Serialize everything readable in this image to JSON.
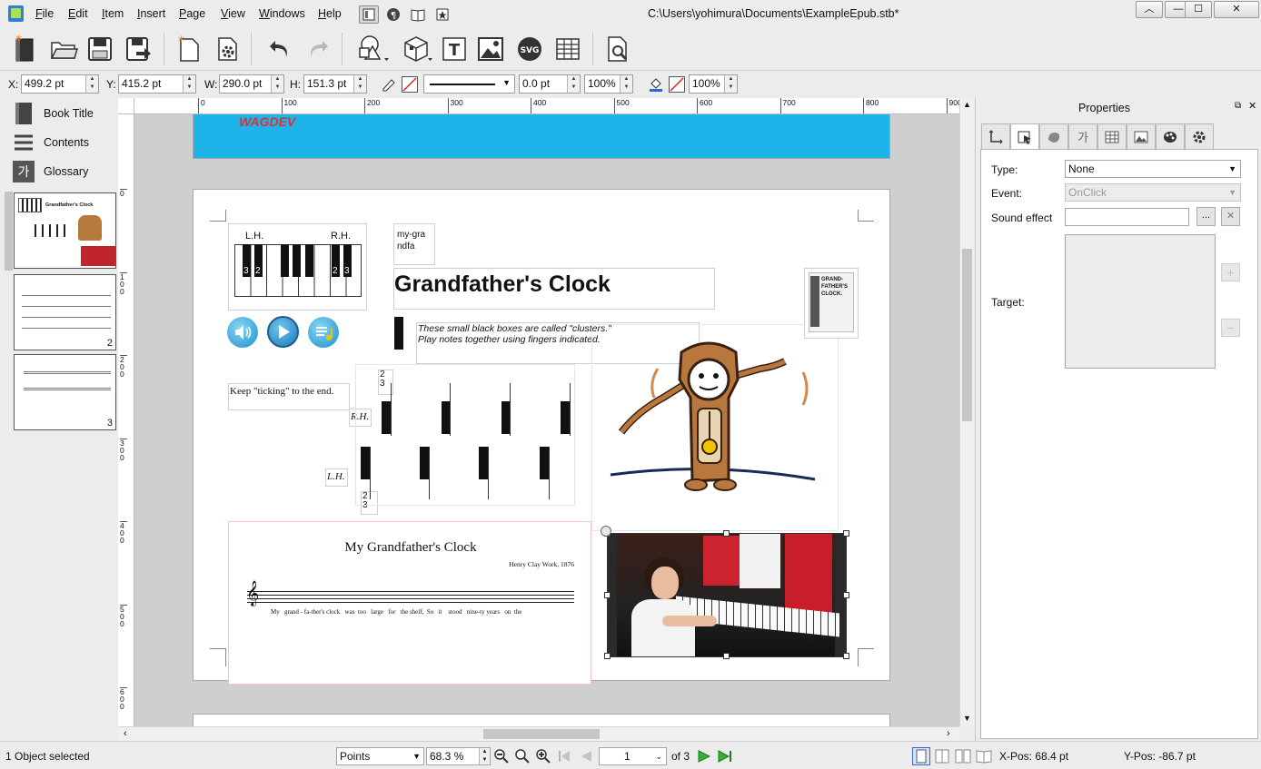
{
  "menubar": {
    "items": [
      "File",
      "Edit",
      "Item",
      "Insert",
      "Page",
      "View",
      "Windows",
      "Help"
    ],
    "window_title": "C:\\Users\\yohimura\\Documents\\ExampleEpub.stb*"
  },
  "window_controls": {
    "collapse": "︿",
    "minimize": "—",
    "maximize": "☐",
    "close": "✕"
  },
  "geometry": {
    "x_label": "X:",
    "x_value": "499.2 pt",
    "y_label": "Y:",
    "y_value": "415.2 pt",
    "w_label": "W:",
    "w_value": "290.0 pt",
    "h_label": "H:",
    "h_value": "151.3 pt",
    "line_width": "0.0 pt",
    "line_opacity": "100%",
    "fill_opacity": "100%"
  },
  "sidebar": {
    "items": [
      {
        "label": "Book Title"
      },
      {
        "label": "Contents"
      },
      {
        "label": "Glossary",
        "icon_text": "가"
      }
    ],
    "thumbnails": [
      {
        "title": "Grandfather's Clock",
        "page": ""
      },
      {
        "page": "2"
      },
      {
        "page": "3"
      }
    ]
  },
  "ruler": {
    "h_ticks": [
      "0",
      "100",
      "200",
      "300",
      "400",
      "500",
      "600",
      "700",
      "800",
      "900"
    ],
    "v_ticks": [
      "0",
      "100",
      "200",
      "300",
      "400",
      "500",
      "600"
    ]
  },
  "document": {
    "header_logo": "WAGDEV",
    "lh_label": "L.H.",
    "rh_label": "R.H.",
    "finger_3": "3",
    "finger_2": "2",
    "small_text": "my-grandfa",
    "title": "Grandfather's Clock",
    "instructions": "These small black boxes are called \"clusters.\" Play notes together using fingers indicated.",
    "keep_ticking": "Keep \"ticking\" to the end.",
    "rh_marker": "R.H.",
    "lh_marker": "L.H.",
    "cluster_finger_top": "2\n3",
    "cluster_finger_bottom": "2\n3",
    "score_title": "My Grandfather's Clock",
    "score_composer": "Henry Clay Work, 1876",
    "score_lyrics": "My   grand - fa-ther's clock   was  too   large   for   the shelf,  So   it    stood   nine-ty years   on  the",
    "cover_text": "GRAND-FATHER'S CLOCK."
  },
  "properties": {
    "title": "Properties",
    "type_label": "Type:",
    "type_value": "None",
    "event_label": "Event:",
    "event_value": "OnClick",
    "sound_label": "Sound effect",
    "sound_value": "",
    "browse_label": "...",
    "target_label": "Target:"
  },
  "statusbar": {
    "selection": "1 Object selected",
    "units": "Points",
    "zoom": "68.3 %",
    "page_value": "1",
    "page_of": "of 3",
    "xpos": "X-Pos: 68.4 pt",
    "ypos": "Y-Pos: -86.7 pt"
  },
  "colors": {
    "header_blue": "#1eb4ea",
    "arrow_green": "#32b432",
    "selection_handle": "#333333"
  }
}
